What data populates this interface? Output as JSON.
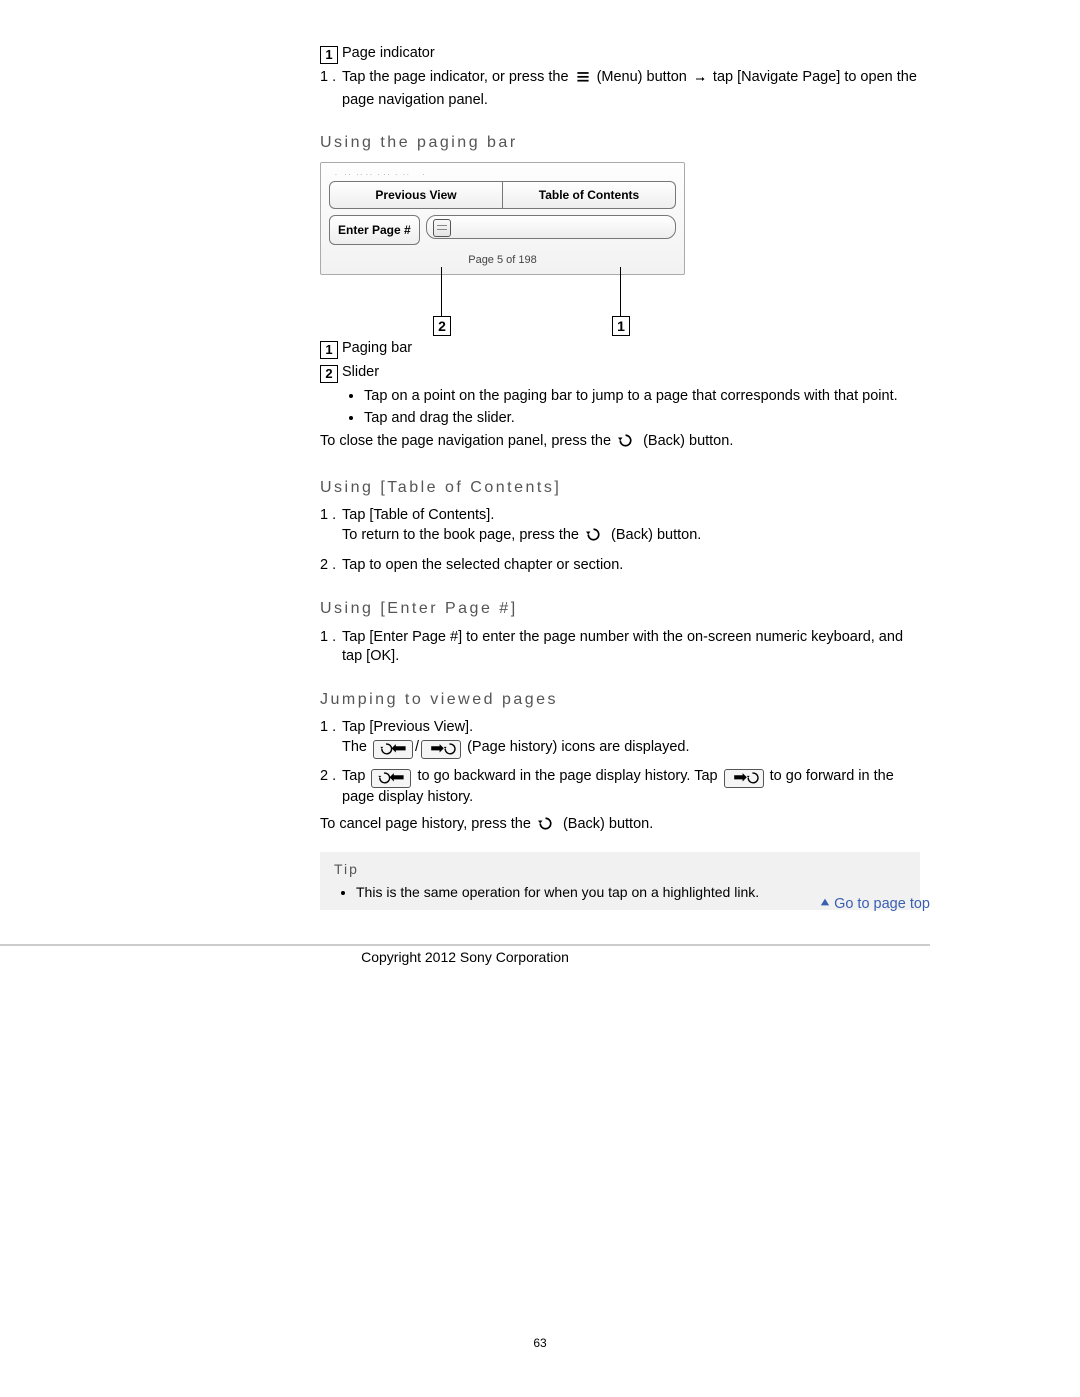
{
  "top_legend": {
    "one_label": "Page indicator",
    "step1_a": "Tap the page indicator, or press the ",
    "step1_b": " (Menu) button ",
    "step1_c": " tap [Navigate Page] to open the page navigation panel."
  },
  "paging_bar": {
    "heading": "Using the paging bar",
    "diagram": {
      "tab_prev": "Previous View",
      "tab_toc": "Table of Contents",
      "enter_btn": "Enter Page #",
      "page_of": "Page 5 of 198"
    },
    "legend1": "Paging bar",
    "legend2": "Slider",
    "bullet_a": "Tap on a point on the paging bar to jump to a page that corresponds with that point.",
    "bullet_b": "Tap and drag the slider.",
    "close_a": "To close the page navigation panel, press the ",
    "close_b": " (Back) button."
  },
  "toc": {
    "heading": "Using [Table of Contents]",
    "step1_a": "Tap [Table of Contents].",
    "step1_b_pre": "To return to the book page, press the ",
    "step1_b_post": " (Back) button.",
    "step2": "Tap to open the selected chapter or section."
  },
  "enter": {
    "heading": "Using [Enter Page #]",
    "step1": "Tap [Enter Page #] to enter the page number with the on-screen numeric keyboard, and tap [OK]."
  },
  "jump": {
    "heading": "Jumping to viewed pages",
    "step1_a": "Tap [Previous View].",
    "step1_b_pre": "The ",
    "step1_b_post": " (Page history) icons are displayed.",
    "step2_a": "Tap ",
    "step2_b": " to go backward in the page display history. Tap ",
    "step2_c": " to go forward in the page display history.",
    "cancel_a": "To cancel page history, press the ",
    "cancel_b": " (Back) button."
  },
  "tip": {
    "title": "Tip",
    "bullet": "This is the same operation for when you tap on a highlighted link."
  },
  "footer": {
    "goto": "Go to page top",
    "copyright": "Copyright 2012 Sony Corporation",
    "page_num": "63"
  }
}
